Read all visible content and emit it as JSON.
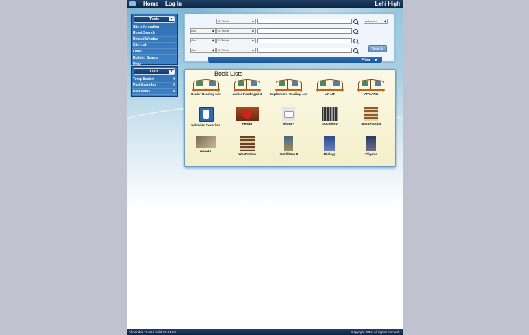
{
  "topbar": {
    "home": "Home",
    "login": "Log In",
    "site_name": "Lehi High"
  },
  "tools_menu": {
    "title": "Tools",
    "items": [
      "Site Information",
      "Reset Search",
      "Reload Window",
      "Site List",
      "Links",
      "Bulletin Boards",
      "Help"
    ]
  },
  "lists_menu": {
    "title": "Lists",
    "items": [
      {
        "label": "Temp Basket",
        "count": "0"
      },
      {
        "label": "Past Searches",
        "count": "0"
      },
      {
        "label": "Past Items",
        "count": "0"
      }
    ]
  },
  "search": {
    "rows": [
      {
        "bool": "",
        "field": "All Words"
      },
      {
        "bool": "And",
        "field": "All Words"
      },
      {
        "bool": "And",
        "field": "All Words"
      },
      {
        "bool": "And",
        "field": "All Words"
      }
    ],
    "mode": "Advanced",
    "search_label": "Search",
    "filter_label": "Filter"
  },
  "book_lists": {
    "title": "Book Lists",
    "items": [
      {
        "label": "Senior Reading List",
        "icon": "open-book-icon"
      },
      {
        "label": "Junior Reading List",
        "icon": "open-book-icon"
      },
      {
        "label": "Sophomore Reading List",
        "icon": "open-book-icon"
      },
      {
        "label": "AP LIT",
        "icon": "open-book-icon"
      },
      {
        "label": "AP LANG",
        "icon": "open-book-icon"
      },
      {
        "label": "Librarian Favorites",
        "icon": "librarian-icon"
      },
      {
        "label": "Health",
        "icon": "apple-icon"
      },
      {
        "label": "History",
        "icon": "history-icon"
      },
      {
        "label": "Sociology",
        "icon": "crowd-icon"
      },
      {
        "label": "Most Popular",
        "icon": "book-stack-icon"
      },
      {
        "label": "ebooks",
        "icon": "ebook-icon"
      },
      {
        "label": "What's New",
        "icon": "new-books-icon"
      },
      {
        "label": "World War II",
        "icon": "ww2-icon"
      },
      {
        "label": "Biology",
        "icon": "biology-icon"
      },
      {
        "label": "Physics",
        "icon": "physics-icon"
      }
    ]
  },
  "footer": {
    "version": "Alexandria v6.22.6 build 20101221",
    "copyright": "Copyright 2016. All rights reserved."
  },
  "colors": {
    "topbar": "#0c2443",
    "menu": "#2f6db1",
    "panel_border": "#6c9ecb",
    "panel_fill": "#f4efc9"
  }
}
